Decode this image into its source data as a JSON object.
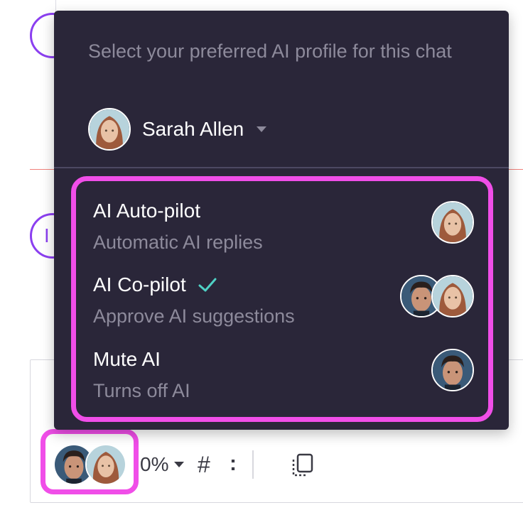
{
  "panel": {
    "title": "Select your preferred AI profile for this chat",
    "profile": {
      "name": "Sarah Allen"
    },
    "options": [
      {
        "label": "AI Auto-pilot",
        "description": "Automatic AI replies",
        "selected": false,
        "avatars": [
          "female"
        ]
      },
      {
        "label": "AI Co-pilot",
        "description": "Approve AI suggestions",
        "selected": true,
        "avatars": [
          "male",
          "female"
        ]
      },
      {
        "label": "Mute AI",
        "description": "Turns off AI",
        "selected": false,
        "avatars": [
          "male"
        ]
      }
    ]
  },
  "toolbar": {
    "percent_label": "0%",
    "hash_label": "#",
    "colon_label": ":",
    "icons": [
      "avatar-toggle",
      "caret-down-icon",
      "hash-icon",
      "more-icon",
      "copy-icon"
    ]
  },
  "background": {
    "avatar_letter": "I"
  },
  "colors": {
    "panel_bg": "#2a2639",
    "highlight": "#f04ee8",
    "accent_purple": "#8b3ff0",
    "check": "#4fd1c5",
    "muted_text": "#8d8a9b"
  }
}
